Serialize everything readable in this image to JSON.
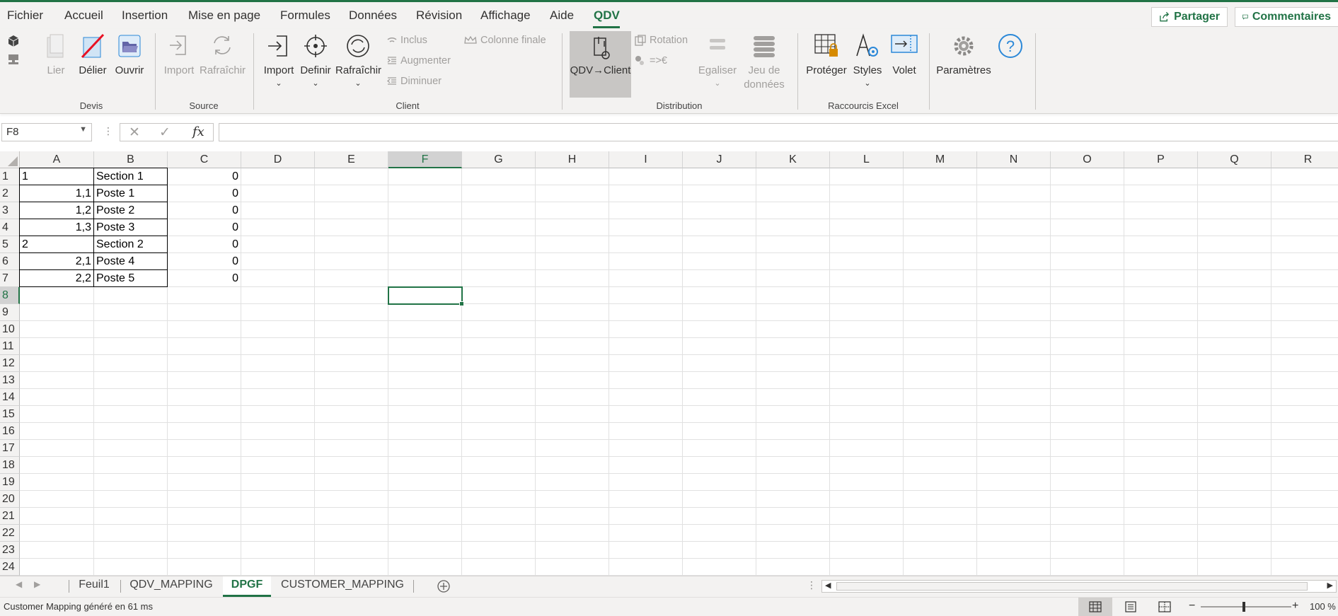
{
  "menu": {
    "tabs": [
      "Fichier",
      "Accueil",
      "Insertion",
      "Mise en page",
      "Formules",
      "Données",
      "Révision",
      "Affichage",
      "Aide",
      "QDV"
    ],
    "active_tab": "QDV",
    "share": "Partager",
    "comments": "Commentaires"
  },
  "ribbon": {
    "devis": {
      "group": "Devis",
      "lier": "Lier",
      "delier": "Délier",
      "ouvrir": "Ouvrir"
    },
    "source": {
      "group": "Source",
      "import": "Import",
      "rafraichir": "Rafraîchir"
    },
    "client": {
      "group": "Client",
      "import": "Import",
      "definir": "Definir",
      "rafraichir": "Rafraîchir",
      "inclus": "Inclus",
      "augmenter": "Augmenter",
      "diminuer": "Diminuer",
      "colonne_finale": "Colonne finale"
    },
    "distribution": {
      "group": "Distribution",
      "qdv_client": "QDV→Client",
      "rotation": "Rotation",
      "euro": "=>€",
      "egaliser": "Egaliser",
      "jeu_de": "Jeu de",
      "donnees": "données"
    },
    "raccourcis": {
      "group": "Raccourcis Excel",
      "proteger": "Protéger",
      "styles": "Styles",
      "volet": "Volet"
    },
    "parametres": "Paramètres"
  },
  "formula_bar": {
    "name_box": "F8",
    "formula": ""
  },
  "columns": [
    "A",
    "B",
    "C",
    "D",
    "E",
    "F",
    "G",
    "H",
    "I",
    "J",
    "K",
    "L",
    "M",
    "N",
    "O",
    "P",
    "Q",
    "R"
  ],
  "rows": [
    "1",
    "2",
    "3",
    "4",
    "5",
    "6",
    "7",
    "8",
    "9",
    "10",
    "11",
    "12",
    "13",
    "14",
    "15",
    "16",
    "17",
    "18",
    "19",
    "20",
    "21",
    "22",
    "23",
    "24"
  ],
  "selected": {
    "col": "F",
    "row": "8"
  },
  "cells": {
    "A1": "1",
    "B1": "Section 1",
    "C1": "0",
    "A2": "1,1",
    "B2": "Poste 1",
    "C2": "0",
    "A3": "1,2",
    "B3": "Poste 2",
    "C3": "0",
    "A4": "1,3",
    "B4": "Poste 3",
    "C4": "0",
    "A5": "2",
    "B5": "Section 2",
    "C5": "0",
    "A6": "2,1",
    "B6": "Poste 4",
    "C6": "0",
    "A7": "2,2",
    "B7": "Poste 5",
    "C7": "0"
  },
  "sheets": [
    "Feuil1",
    "QDV_MAPPING",
    "DPGF",
    "CUSTOMER_MAPPING"
  ],
  "active_sheet": "DPGF",
  "status": {
    "message": "Customer Mapping généré en 61 ms",
    "zoom": "100 %"
  },
  "colors": {
    "accent": "#217346",
    "ribbon_bg": "#f3f2f1"
  }
}
